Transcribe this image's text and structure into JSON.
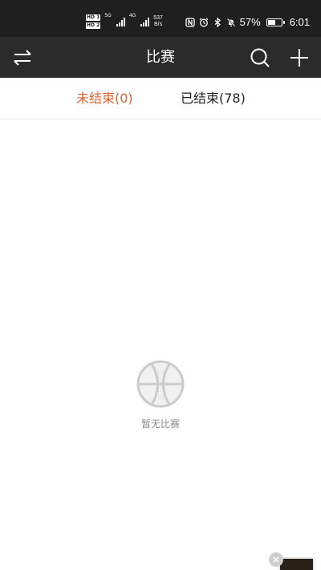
{
  "status_bar": {
    "hd1": "HD 1",
    "hd2": "HD 2",
    "net1": "5G",
    "net2": "4G",
    "speed_value": "537",
    "speed_unit": "B/s",
    "battery_percent": "57%",
    "battery_level": 0.57,
    "time": "6:01"
  },
  "header": {
    "title": "比赛"
  },
  "tabs": [
    {
      "label": "未结束(0)",
      "active": true
    },
    {
      "label": "已结束(78)",
      "active": false
    }
  ],
  "empty_state": {
    "message": "暂无比赛"
  },
  "colors": {
    "accent": "#e0602c",
    "header_bg": "#2b2b2b",
    "status_bg": "#1f1f1f"
  }
}
